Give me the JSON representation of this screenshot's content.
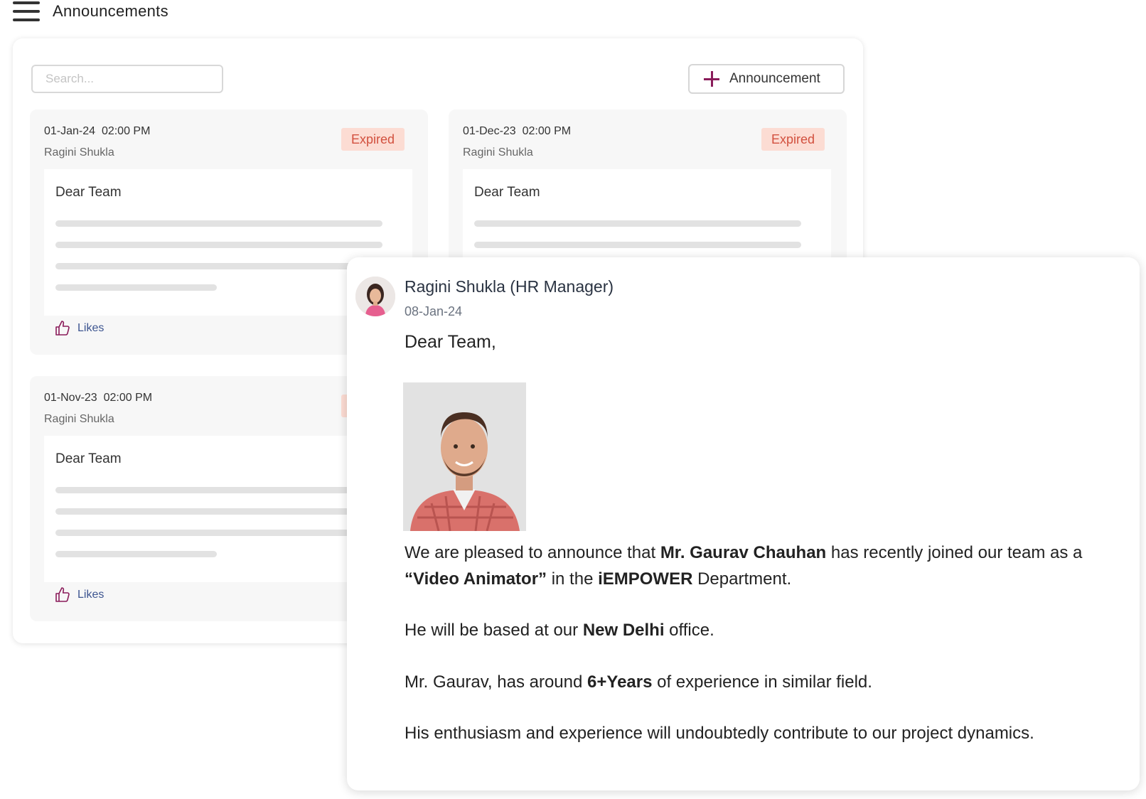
{
  "header": {
    "title": "Announcements"
  },
  "toolbar": {
    "search_placeholder": "Search...",
    "add_label": "Announcement"
  },
  "colors": {
    "accent": "#8a1c5a",
    "expired_bg": "#fcdcd3",
    "expired_text": "#d2503e",
    "likes_text": "#3d5590"
  },
  "cards": [
    {
      "date": "01-Jan-24",
      "time": "02:00 PM",
      "author": "Ragini Shukla",
      "status": "Expired",
      "greeting": "Dear Team",
      "likes_label": "Likes"
    },
    {
      "date": "01-Dec-23",
      "time": "02:00 PM",
      "author": "Ragini Shukla",
      "status": "Expired",
      "greeting": "Dear Team"
    },
    {
      "date": "01-Nov-23",
      "time": "02:00 PM",
      "author": "Ragini Shukla",
      "greeting": "Dear Team",
      "likes_label": "Likes"
    }
  ],
  "popup": {
    "author": "Ragini Shukla (HR Manager)",
    "date": "08-Jan-24",
    "greeting": "Dear Team,",
    "p1": {
      "t1": "We are pleased to announce that ",
      "b1": "Mr. Gaurav Chauhan",
      "t2": " has recently joined our team as a ",
      "b2": "“Video Animator”",
      "t3": " in the ",
      "b3": "iEMPOWER",
      "t4": " Department."
    },
    "p2": {
      "t1": "He will be based at our ",
      "b1": "New Delhi",
      "t2": " office."
    },
    "p3": {
      "t1": "Mr. Gaurav, has around ",
      "b1": "6+Years",
      "t2": " of experience in similar field."
    },
    "p4": "His enthusiasm and experience will undoubtedly contribute to our project dynamics."
  }
}
